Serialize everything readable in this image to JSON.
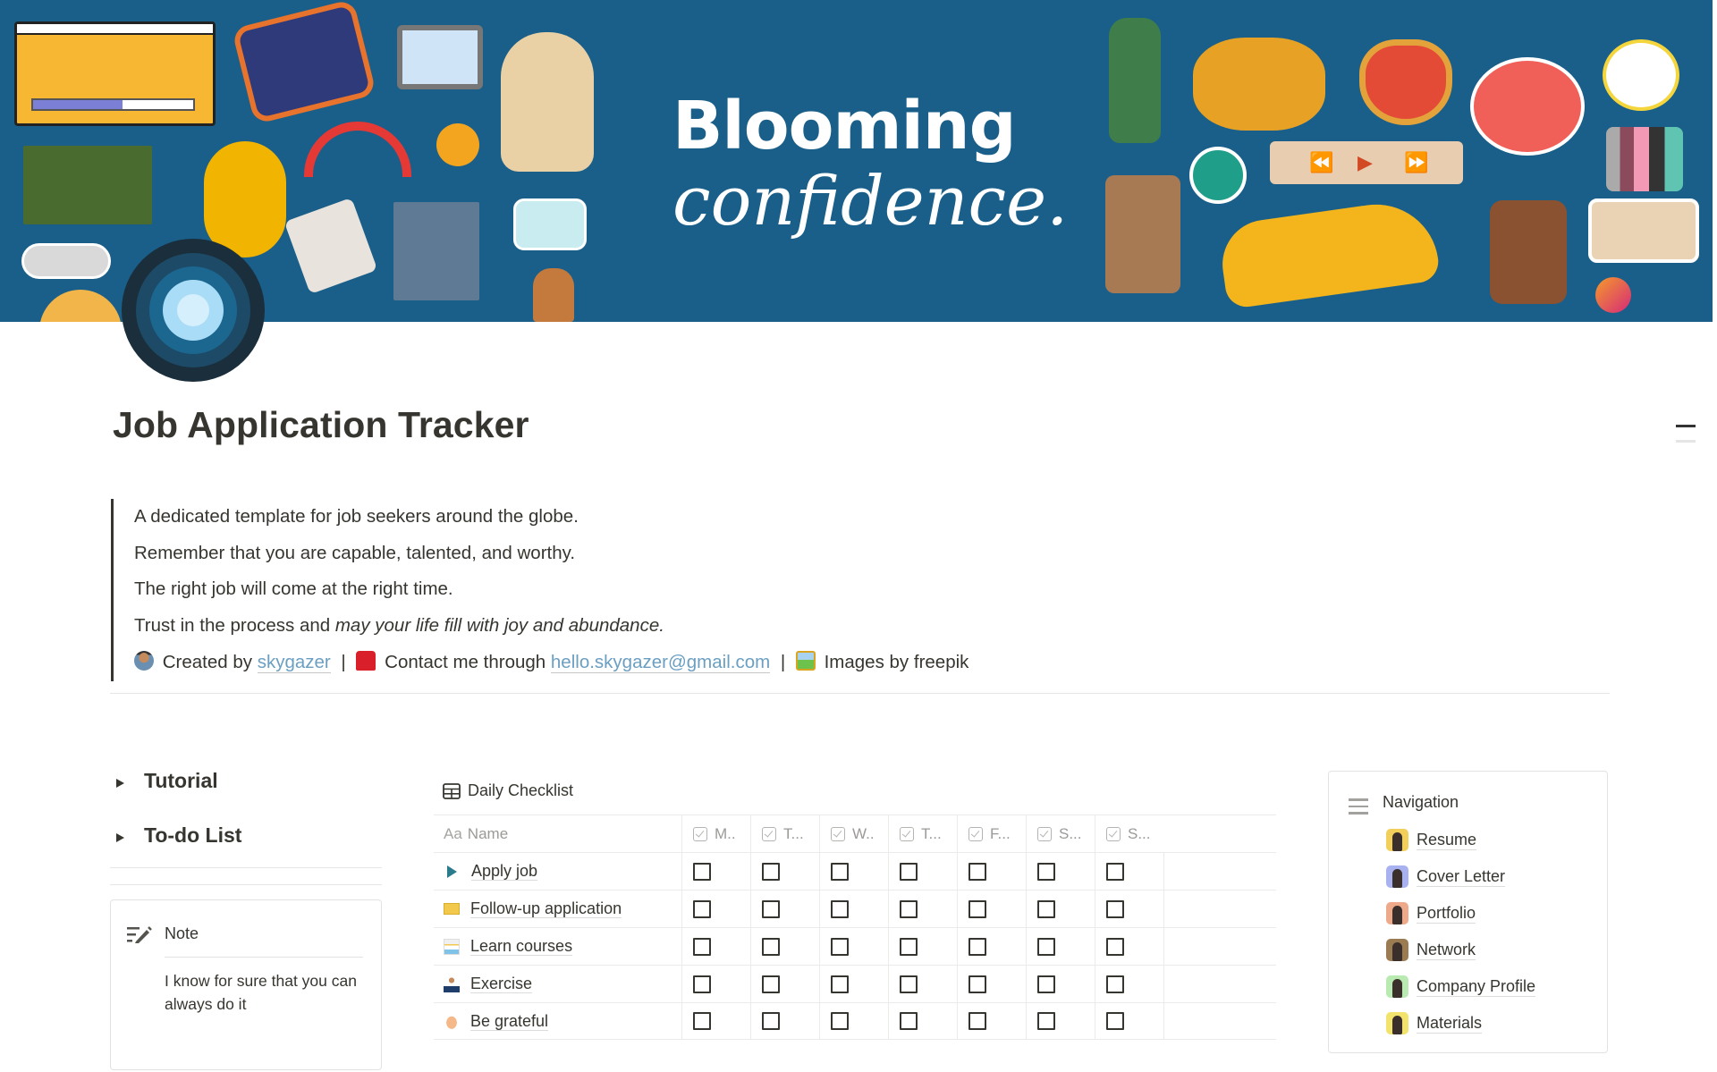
{
  "banner": {
    "headline": "Blooming",
    "tagline": "confidence.",
    "background_color": "#1a5f89",
    "player_controls": [
      "rewind",
      "play",
      "fast-forward"
    ]
  },
  "page": {
    "title": "Job Application Tracker"
  },
  "quote": {
    "lines": [
      "A dedicated template for job seekers around the globe.",
      "Remember that you are capable, talented, and worthy.",
      "The right job will come at the right time."
    ],
    "trust_prefix": "Trust in the process and ",
    "trust_italic": "may your life fill with joy and abundance.",
    "credits": {
      "created_by_label": "Created by",
      "creator_link": "skygazer",
      "separator": "|",
      "contact_label": "Contact me through",
      "contact_email": "hello.skygazer@gmail.com",
      "images_label": "Images by freepik"
    },
    "link_color": "#6b9fc2"
  },
  "toggles": [
    {
      "label": "Tutorial"
    },
    {
      "label": "To-do List"
    }
  ],
  "note": {
    "title": "Note",
    "body": "I know for sure that you can always do it"
  },
  "checklist": {
    "title": "Daily Checklist",
    "name_header_prefix": "Aa",
    "name_header": "Name",
    "day_headers": [
      "M..",
      "T...",
      "W..",
      "T...",
      "F...",
      "S...",
      "S..."
    ],
    "rows": [
      {
        "icon": "play-triangle-icon",
        "name": "Apply job",
        "checks": [
          false,
          false,
          false,
          false,
          false,
          false,
          false
        ]
      },
      {
        "icon": "envelope-icon",
        "name": "Follow-up application",
        "checks": [
          false,
          false,
          false,
          false,
          false,
          false,
          false
        ]
      },
      {
        "icon": "books-icon",
        "name": "Learn courses",
        "checks": [
          false,
          false,
          false,
          false,
          false,
          false,
          false
        ]
      },
      {
        "icon": "meditation-icon",
        "name": "Exercise",
        "checks": [
          false,
          false,
          false,
          false,
          false,
          false,
          false
        ]
      },
      {
        "icon": "praying-hands-icon",
        "name": "Be grateful",
        "checks": [
          false,
          false,
          false,
          false,
          false,
          false,
          false
        ]
      }
    ]
  },
  "navigation": {
    "title": "Navigation",
    "items": [
      {
        "label": "Resume",
        "thumb_color": "#f2cf5b"
      },
      {
        "label": "Cover Letter",
        "thumb_color": "#a9b2f0"
      },
      {
        "label": "Portfolio",
        "thumb_color": "#eea98a"
      },
      {
        "label": "Network",
        "thumb_color": "#9a7b52"
      },
      {
        "label": "Company Profile",
        "thumb_color": "#b9eab2"
      },
      {
        "label": "Materials",
        "thumb_color": "#f1e36b"
      }
    ]
  }
}
